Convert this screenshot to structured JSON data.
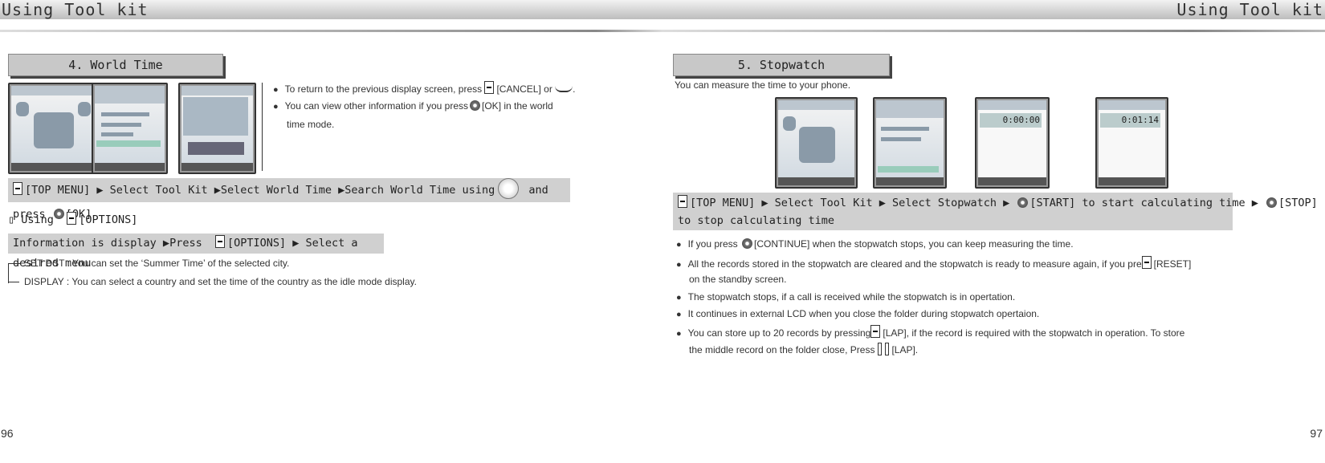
{
  "header": {
    "left_title": "Using Tool kit",
    "right_title": "Using Tool kit"
  },
  "left": {
    "section_title": "4. World Time",
    "bullets": [
      "To return to the previous display screen, press [CANCEL] or .",
      "You can view other information if you press [OK] in the world",
      "time mode."
    ],
    "bullets_parts": {
      "b1a": "To return to the previous display screen, press",
      "b1b": "[CANCEL] or",
      "b2a": "You can view other information if you press",
      "b2b": "[OK] in the world",
      "b2c": "time mode."
    },
    "procedure": {
      "p1": "[TOP MENU] ▶ Select Tool Kit ▶Select World Time ▶Search World Time using",
      "p2": "and press",
      "p3": "[OK]"
    },
    "using": {
      "marker": "▯",
      "label": "Using",
      "key": "[OPTIONS]"
    },
    "options_bar": {
      "p1": "Information is display ▶Press",
      "p2": "[OPTIONS] ▶ Select a desired menu"
    },
    "options": [
      "SET DST : You can set the ‘Summer Time’ of the selected city.",
      "DISPLAY : You can select a country and set the time of the country as the idle mode display."
    ],
    "page_number": "96"
  },
  "right": {
    "section_title": "5. Stopwatch",
    "intro": "You can measure the time to your phone.",
    "screens": [
      "0:00:00",
      "0:01:14"
    ],
    "procedure": {
      "p1": "[TOP MENU] ▶ Select Tool Kit ▶ Select Stopwatch ▶",
      "p2": "[START] to start calculating time ▶",
      "p3": "[STOP]",
      "p4": "to stop calculating time"
    },
    "bullets": {
      "b1a": "If you press",
      "b1b": "[CONTINUE] when the stopwatch stops, you can keep measuring the time.",
      "b2a": "All the records stored in the stopwatch are cleared and the stopwatch is ready to measure again, if you pre",
      "b2b": "[RESET]",
      "b2c": "on the standby screen.",
      "b3": "The stopwatch stops, if a call is received while the stopwatch is in opertation.",
      "b4": "It continues in external LCD when you close the folder during stopwatch opertaion.",
      "b5a": "You can store up to 20 records by pressing",
      "b5b": "[LAP], if the record is required with the stopwatch in operation. To store",
      "b5c": "the middle record on the folder close, Press",
      "b5d": "[LAP]."
    },
    "page_number": "97"
  }
}
